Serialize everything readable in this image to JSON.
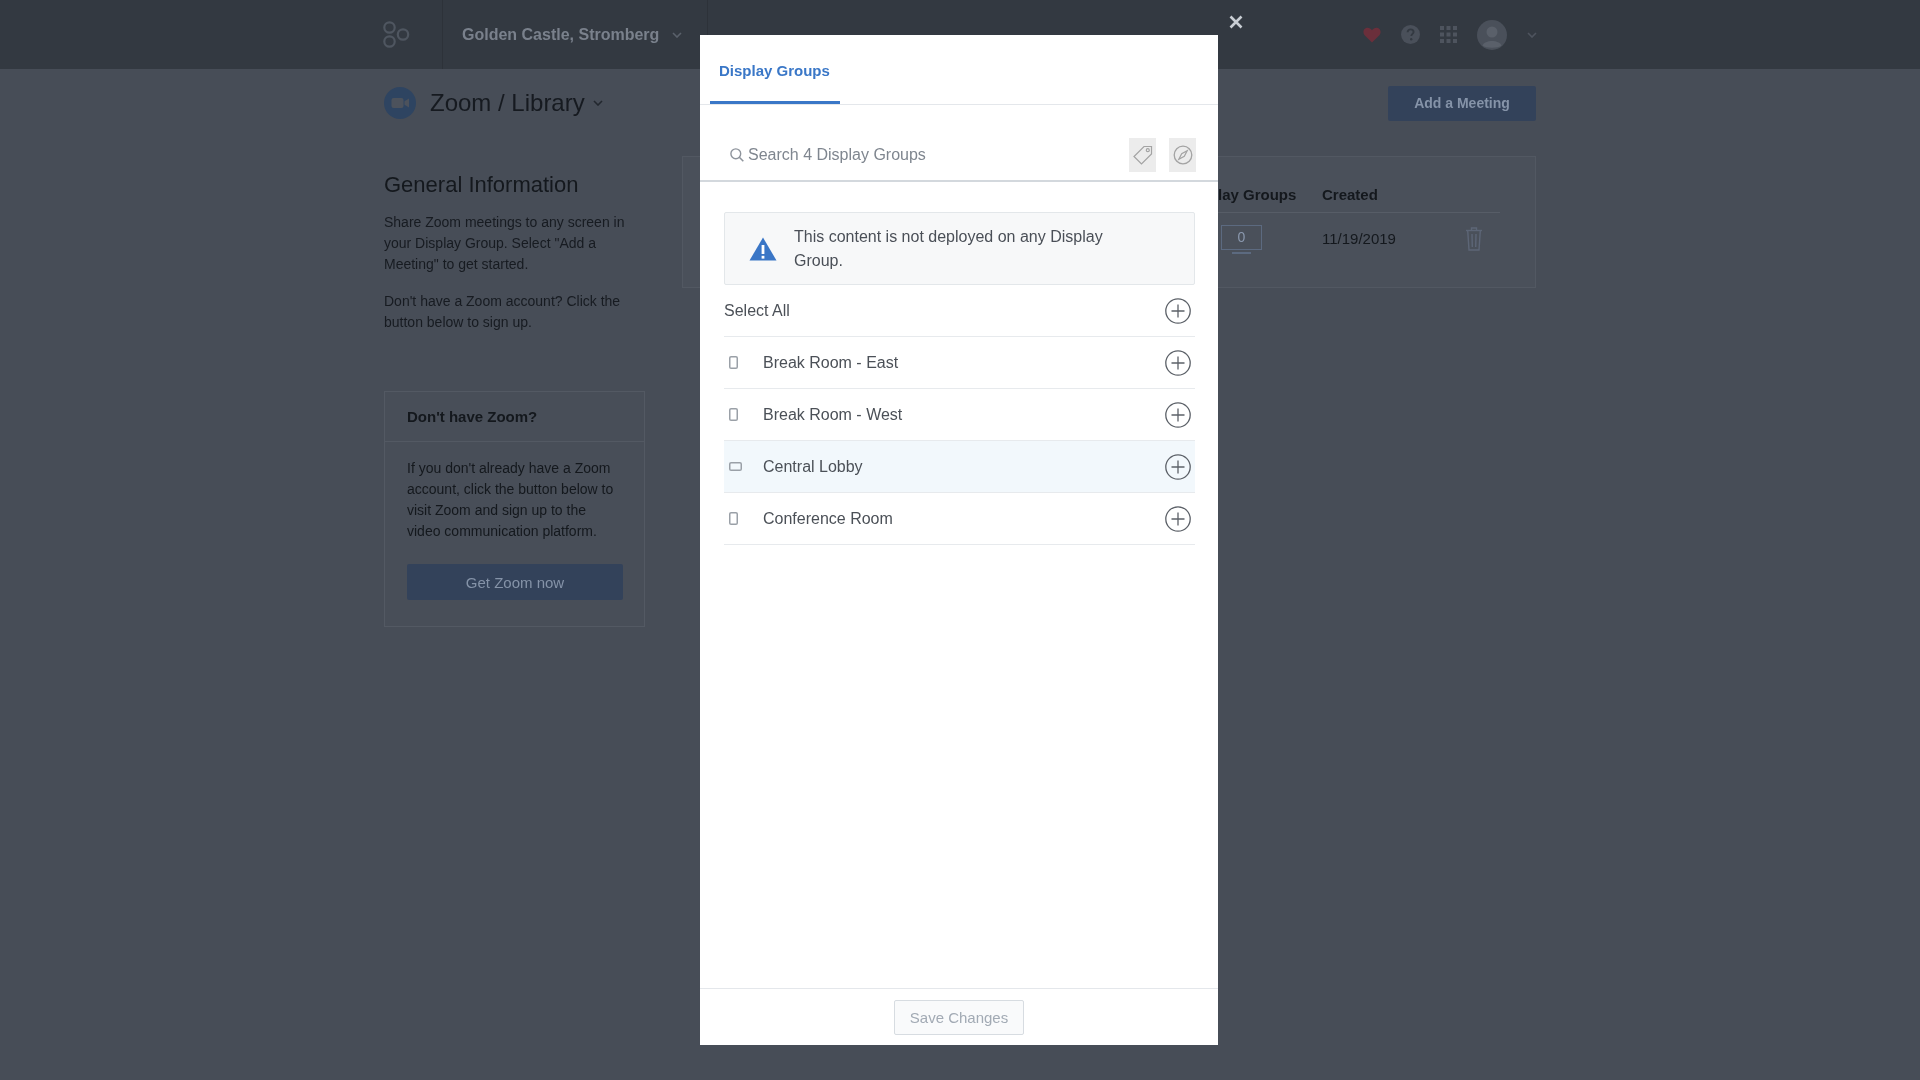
{
  "top_bar": {
    "location": "Golden Castle, Stromberg"
  },
  "page": {
    "title": "Zoom / Library",
    "add_button": "Add a Meeting"
  },
  "info": {
    "heading": "General Information",
    "paragraphs": [
      "Share Zoom meetings to any screen in your Display Group. Select \"Add a Meeting\" to get started.",
      "Don't have a Zoom account? Click the button below to sign up."
    ],
    "card": {
      "title": "Don't have Zoom?",
      "text": "If you don't already have a Zoom account, click the button below to visit Zoom and sign up to the video communication platform.",
      "button": "Get Zoom now"
    }
  },
  "table": {
    "columns": [
      "lay Groups",
      "Created"
    ],
    "rows": [
      {
        "cells": [
          "0",
          "11/19/2019"
        ]
      }
    ]
  },
  "modal": {
    "tabs": [
      {
        "label": "Display Groups",
        "selected": true
      }
    ],
    "search": {
      "placeholder": "Search 4 Display Groups"
    },
    "notice": "This content is not deployed on any Display Group.",
    "select_all": "Select All",
    "groups": [
      {
        "name": "Break Room - East",
        "kind": "portrait",
        "highlighted": false
      },
      {
        "name": "Break Room - West",
        "kind": "portrait",
        "highlighted": false
      },
      {
        "name": "Central Lobby",
        "kind": "landscape",
        "highlighted": true
      },
      {
        "name": "Conference Room",
        "kind": "portrait",
        "highlighted": false
      }
    ],
    "save_button": {
      "label": "Save Changes",
      "disabled": true
    }
  }
}
